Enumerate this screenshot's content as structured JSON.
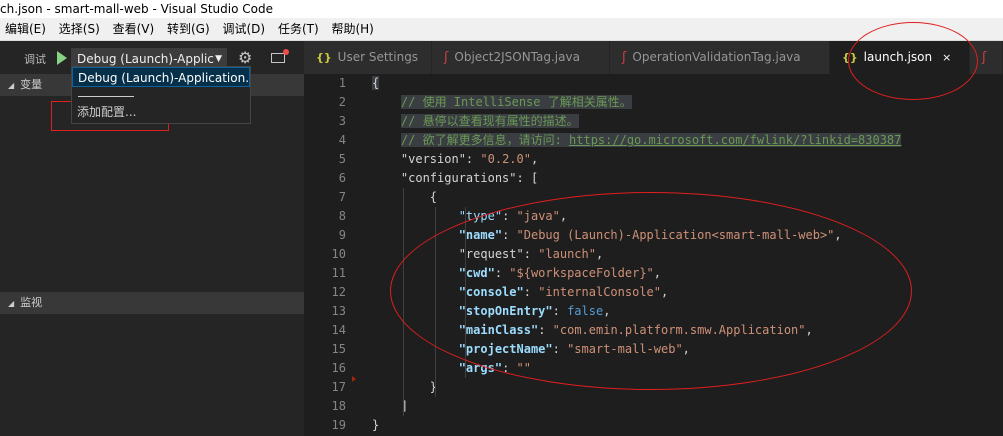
{
  "window": {
    "title": "ch.json - smart-mall-web - Visual Studio Code"
  },
  "menu": [
    "编辑(E)",
    "选择(S)",
    "查看(V)",
    "转到(G)",
    "调试(D)",
    "任务(T)",
    "帮助(H)"
  ],
  "debug": {
    "title": "调试",
    "config_selected": "Debug (Launch)-Applic",
    "dropdown": {
      "item_config": "Debug (Launch)-Application..",
      "item_add": "添加配置..."
    }
  },
  "sidebar": {
    "sections": [
      {
        "label": "变量"
      },
      {
        "label": "监视"
      }
    ]
  },
  "tabs": [
    {
      "icon": "{}",
      "label": "User Settings",
      "icon_name": "json-icon"
    },
    {
      "icon": "ʃ",
      "label": "Object2JSONTag.java",
      "icon_name": "java-icon"
    },
    {
      "icon": "ʃ",
      "label": "OperationValidationTag.java",
      "icon_name": "java-icon"
    },
    {
      "icon": "{}",
      "label": "launch.json",
      "icon_name": "json-icon",
      "active": true,
      "close": "×"
    }
  ],
  "editor": {
    "lines": [
      {
        "n": "1",
        "parts": [
          [
            "p",
            "{"
          ]
        ]
      },
      {
        "n": "2",
        "parts": [
          [
            "c",
            "// 使用 IntelliSense 了解相关属性。"
          ]
        ]
      },
      {
        "n": "3",
        "parts": [
          [
            "c",
            "// 悬停以查看现有属性的描述。"
          ]
        ]
      },
      {
        "n": "4",
        "parts": [
          [
            "c",
            "// 欲了解更多信息，请访问: "
          ],
          [
            "u",
            "https://go.microsoft.com/fwlink/?linkid=830387"
          ]
        ]
      },
      {
        "n": "5",
        "parts": [
          [
            "p",
            "\"version\": "
          ],
          [
            "s",
            "\"0.2.0\""
          ],
          [
            "p",
            ","
          ]
        ]
      },
      {
        "n": "6",
        "parts": [
          [
            "p",
            "\"configurations\": ["
          ]
        ]
      },
      {
        "n": "7",
        "parts": [
          [
            "p",
            "{"
          ]
        ]
      },
      {
        "n": "8",
        "parts": [
          [
            "k",
            "\"type\""
          ],
          [
            "p",
            ": "
          ],
          [
            "s",
            "\"java\""
          ],
          [
            "p",
            ","
          ]
        ]
      },
      {
        "n": "9",
        "parts": [
          [
            "kb",
            "\"name\""
          ],
          [
            "p",
            ": "
          ],
          [
            "s",
            "\"Debug (Launch)-Application<smart-mall-web>\""
          ],
          [
            "p",
            ","
          ]
        ]
      },
      {
        "n": "10",
        "parts": [
          [
            "p",
            "\"request\": "
          ],
          [
            "s",
            "\"launch\""
          ],
          [
            "p",
            ","
          ]
        ]
      },
      {
        "n": "11",
        "parts": [
          [
            "kb",
            "\"cwd\""
          ],
          [
            "p",
            ": "
          ],
          [
            "s",
            "\"${workspaceFolder}\""
          ],
          [
            "p",
            ","
          ]
        ]
      },
      {
        "n": "12",
        "parts": [
          [
            "kb",
            "\"console\""
          ],
          [
            "p",
            ": "
          ],
          [
            "s",
            "\"internalConsole\""
          ],
          [
            "p",
            ","
          ]
        ]
      },
      {
        "n": "13",
        "parts": [
          [
            "kb",
            "\"stopOnEntry\""
          ],
          [
            "p",
            ": "
          ],
          [
            "b",
            "false"
          ],
          [
            "p",
            ","
          ]
        ]
      },
      {
        "n": "14",
        "parts": [
          [
            "kb",
            "\"mainClass\""
          ],
          [
            "p",
            ": "
          ],
          [
            "s",
            "\"com.emin.platform.smw.Application\""
          ],
          [
            "p",
            ","
          ]
        ]
      },
      {
        "n": "15",
        "parts": [
          [
            "kb",
            "\"projectName\""
          ],
          [
            "p",
            ": "
          ],
          [
            "s",
            "\"smart-mall-web\""
          ],
          [
            "p",
            ","
          ]
        ]
      },
      {
        "n": "16",
        "parts": [
          [
            "kb",
            "\"args\""
          ],
          [
            "p",
            ": "
          ],
          [
            "s",
            "\"\""
          ]
        ]
      },
      {
        "n": "17",
        "parts": [
          [
            "p",
            "}"
          ]
        ]
      },
      {
        "n": "18",
        "parts": [
          [
            "p",
            "]"
          ]
        ]
      },
      {
        "n": "19",
        "parts": [
          [
            "p",
            "}"
          ]
        ]
      }
    ]
  },
  "colors": {
    "accent": "#0e639c",
    "annotation": "#e01f1f",
    "comment": "#6a9955",
    "string": "#ce9178",
    "key": "#9cdcfe"
  }
}
